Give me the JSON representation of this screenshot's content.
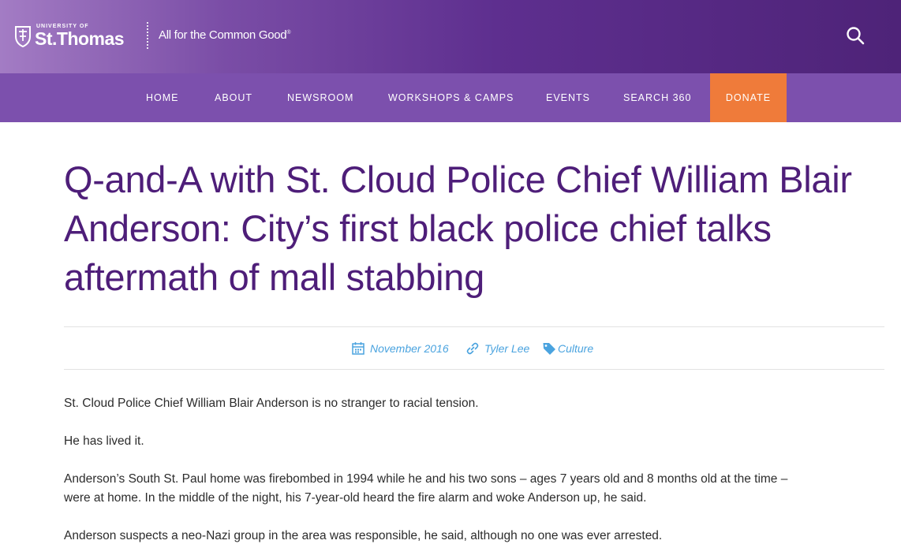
{
  "header": {
    "logo_small": "UNIVERSITY OF",
    "logo_big": "St.Thomas",
    "tagline": "All for the Common Good",
    "tagline_mark": "®",
    "search_icon": "search-icon",
    "gradient_colors": [
      "#a37cc4",
      "#4e2378"
    ]
  },
  "nav": {
    "items": [
      {
        "label": "HOME"
      },
      {
        "label": "ABOUT"
      },
      {
        "label": "NEWSROOM"
      },
      {
        "label": "WORKSHOPS & CAMPS"
      },
      {
        "label": "EVENTS"
      },
      {
        "label": "SEARCH 360"
      },
      {
        "label": "DONATE"
      }
    ],
    "bar_color": "#7c50ad",
    "donate_color": "#ef7b3a"
  },
  "article": {
    "title_lines": [
      "Q-and-A with St. Cloud Police Chief William Blair",
      "Anderson: City’s first black police chief talks",
      "aftermath of mall stabbing"
    ],
    "title_color": "#4e1e79",
    "meta": {
      "date": "November 2016",
      "date_icon": "calendar-icon",
      "author": "Tyler Lee",
      "author_icon": "link-icon",
      "category": "Culture",
      "category_icon": "tag-icon",
      "color": "#4aa3df"
    },
    "paragraphs": [
      "St. Cloud Police Chief William Blair Anderson is no stranger to racial tension.",
      "He has lived it.",
      "Anderson’s South St. Paul home was firebombed in 1994 while he and his two sons – ages 7 years old and 8 months old at the time –",
      "were at home. In the middle of the night, his 7-year-old heard the fire alarm and woke Anderson up, he said.",
      "Anderson suspects a neo-Nazi group in the area was responsible, he said, although no one was ever arrested."
    ]
  }
}
